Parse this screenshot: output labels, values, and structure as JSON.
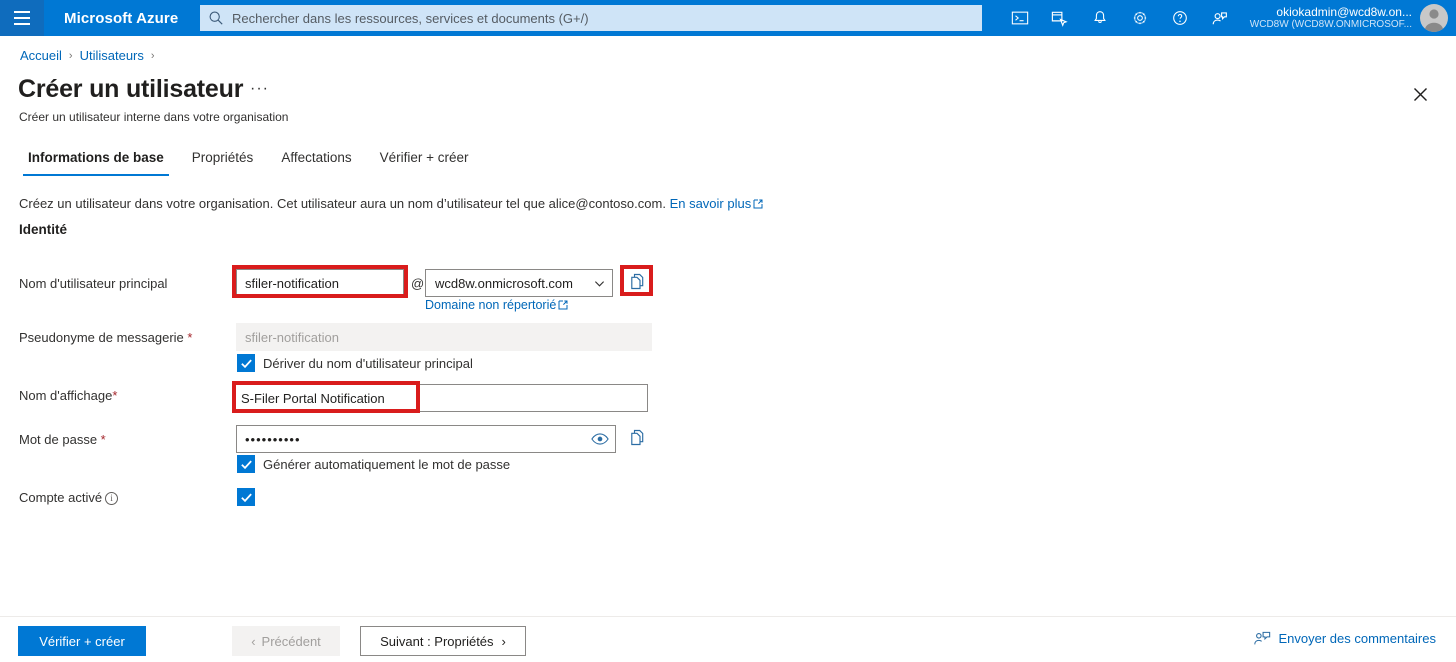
{
  "topbar": {
    "menu_icon": "hamburger-icon",
    "brand": "Microsoft Azure",
    "search_placeholder": "Rechercher dans les ressources, services et documents (G+/)",
    "icons": [
      "cloud-shell-icon",
      "directories-subscriptions-icon",
      "notifications-bell-icon",
      "settings-gear-icon",
      "help-question-icon",
      "feedback-smiley-icon"
    ],
    "account_name": "okiokadmin@wcd8w.on...",
    "account_tenant": "WCD8W (WCD8W.ONMICROSOF...",
    "avatar": "user-avatar"
  },
  "breadcrumb": {
    "items": [
      "Accueil",
      "Utilisateurs"
    ],
    "separator": "›"
  },
  "page": {
    "title": "Créer un utilisateur",
    "more_label": "···",
    "subtitle": "Créer un utilisateur interne dans votre organisation",
    "close_label": "close-icon"
  },
  "tabs": [
    {
      "label": "Informations de base",
      "active": true
    },
    {
      "label": "Propriétés",
      "active": false
    },
    {
      "label": "Affectations",
      "active": false
    },
    {
      "label": "Vérifier + créer",
      "active": false
    }
  ],
  "intro": {
    "text": "Créez un utilisateur dans votre organisation. Cet utilisateur aura un nom d’utilisateur tel que alice@contoso.com.",
    "link": "En savoir plus"
  },
  "section": {
    "identity_heading": "Identité"
  },
  "fields": {
    "upn": {
      "label": "Nom d'utilisateur principal",
      "value": "sfiler-notification",
      "at": "@",
      "domain_value": "wcd8w.onmicrosoft.com",
      "domain_link": "Domaine non répertorié",
      "copy_icon": "copy-icon"
    },
    "mail_nickname": {
      "label": "Pseudonyme de messagerie",
      "required_mark": "*",
      "value": "sfiler-notification",
      "derive_checkbox_label": "Dériver du nom d'utilisateur principal",
      "derive_checked": true
    },
    "display_name": {
      "label": "Nom d'affichage",
      "required_mark": "*",
      "value": "S-Filer Portal Notification"
    },
    "password": {
      "label": "Mot de passe",
      "required_mark": "*",
      "value": "••••••••••",
      "reveal_icon": "eye-icon",
      "copy_icon": "copy-icon",
      "autogen_checkbox_label": "Générer automatiquement le mot de passe",
      "autogen_checked": true
    },
    "account_enabled": {
      "label": "Compte activé",
      "info_icon": "info-icon",
      "checked": true
    }
  },
  "footer": {
    "review_create": "Vérifier + créer",
    "previous": "Précédent",
    "previous_chevron": "‹",
    "next": "Suivant : Propriétés",
    "next_chevron": "›",
    "feedback": "Envoyer des commentaires",
    "feedback_icon": "feedback-person-icon"
  },
  "annotations": {
    "highlight_color": "#d91c1c",
    "boxes": [
      "upn-input-highlight",
      "upn-copy-highlight",
      "display-name-highlight",
      "next-button-highlight"
    ]
  }
}
